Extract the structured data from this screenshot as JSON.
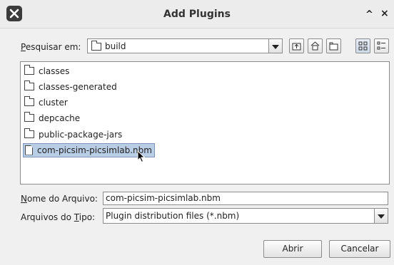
{
  "window": {
    "title": "Add Plugins",
    "titlebar_buttons": [
      "^",
      "×"
    ]
  },
  "lookin": {
    "label_first": "P",
    "label_rest": "esquisar em:",
    "selected": "build"
  },
  "toolbar": {
    "icons": [
      "up-folder-icon",
      "home-icon",
      "new-folder-icon",
      "list-view-icon",
      "details-view-icon"
    ]
  },
  "files": [
    {
      "name": "classes",
      "type": "folder"
    },
    {
      "name": "classes-generated",
      "type": "folder"
    },
    {
      "name": "cluster",
      "type": "folder"
    },
    {
      "name": "depcache",
      "type": "folder"
    },
    {
      "name": "public-package-jars",
      "type": "folder"
    },
    {
      "name": "com-picsim-picsimlab.nbm",
      "type": "file",
      "selected": true
    }
  ],
  "filename": {
    "label_first": "N",
    "label_rest": "ome do Arquivo:",
    "value": "com-picsim-picsimlab.nbm"
  },
  "filetype": {
    "label_before": "Arquivos do ",
    "label_underlined": "T",
    "label_after": "ipo:",
    "value": "Plugin distribution files (*.nbm)"
  },
  "buttons": {
    "open": "Abrir",
    "cancel": "Cancelar"
  },
  "colors": {
    "selection": "#b9cde5",
    "background": "#f0f0f0"
  }
}
